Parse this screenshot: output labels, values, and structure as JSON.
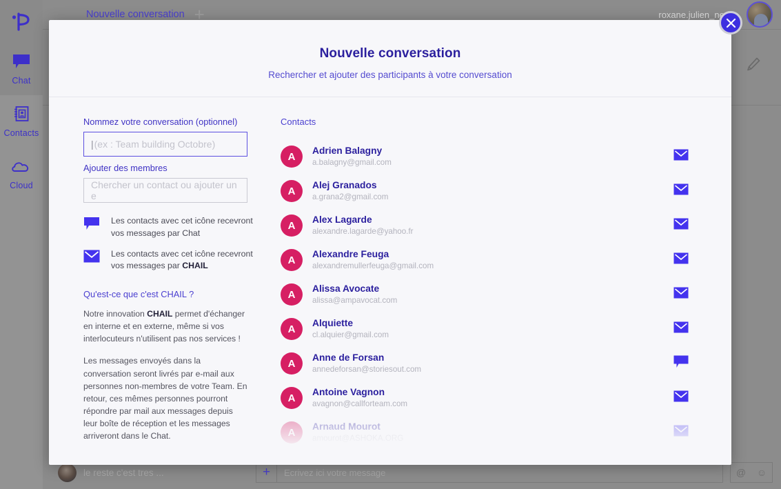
{
  "app": {
    "logo_icon": "phonegroup-p-logo-icon",
    "sidebar": {
      "items": [
        {
          "label": "Chat",
          "icon": "chat-bubble-icon",
          "active": true
        },
        {
          "label": "Contacts",
          "icon": "address-book-icon",
          "active": false
        },
        {
          "label": "Cloud",
          "icon": "cloud-icon",
          "active": false
        }
      ]
    },
    "topbar": {
      "tab_label": "Nouvelle conversation",
      "new_tab_icon": "plus-icon",
      "username": "roxane.julien_newm",
      "avatar_icon": "user-avatar"
    },
    "chat": {
      "edit_icon": "pencil-icon",
      "last_message_snippet": "le reste c'est tres ...",
      "composer_placeholder": "Ecrivez ici votre message",
      "attach_icon": "plus-icon",
      "mention_icon": "at-icon",
      "emoji_icon": "smiley-icon"
    }
  },
  "modal": {
    "title": "Nouvelle conversation",
    "subtitle": "Rechercher et ajouter des participants à votre conversation",
    "close_icon": "close-x-icon",
    "left": {
      "name_label": "Nommez votre conversation (optionnel)",
      "name_value": "",
      "name_placeholder": "(ex : Team building Octobre)",
      "members_label": "Ajouter des membres",
      "members_value": "",
      "members_placeholder": "Chercher un contact ou ajouter un e",
      "legend": [
        {
          "icon": "chat-bubble-icon",
          "text_before": "Les contacts avec cet icône recevront vos messages par ",
          "text_bold": "Chat",
          "bold_is_strong": false
        },
        {
          "icon": "mail-envelope-icon",
          "text_before": "Les contacts avec cet icône recevront vos messages par ",
          "text_bold": "CHAIL",
          "bold_is_strong": true
        }
      ],
      "faq_title": "Qu'est-ce que c'est CHAIL ?",
      "faq_p1_a": "Notre innovation ",
      "faq_p1_b": "CHAIL",
      "faq_p1_c": " permet d'échanger en interne et en externe, même si vos interlocuteurs n'utilisent pas nos services !",
      "faq_p2": "Les messages envoyés dans la conversation seront livrés par e-mail aux personnes non-membres de votre Team. En retour, ces mêmes personnes pourront répondre par mail aux messages depuis leur boîte de réception et les messages arriveront dans le Chat."
    },
    "right": {
      "contacts_label": "Contacts",
      "contacts": [
        {
          "initial": "A",
          "name": "Adrien Balagny",
          "email": "a.balagny@gmail.com",
          "channel": "mail",
          "faded": false
        },
        {
          "initial": "A",
          "name": "Alej Granados",
          "email": "a.grana2@gmail.com",
          "channel": "mail",
          "faded": false
        },
        {
          "initial": "A",
          "name": "Alex Lagarde",
          "email": "alexandre.lagarde@yahoo.fr",
          "channel": "mail",
          "faded": false
        },
        {
          "initial": "A",
          "name": "Alexandre Feuga",
          "email": "alexandremullerfeuga@gmail.com",
          "channel": "mail",
          "faded": false
        },
        {
          "initial": "A",
          "name": "Alissa Avocate",
          "email": "alissa@ampavocat.com",
          "channel": "mail",
          "faded": false
        },
        {
          "initial": "A",
          "name": "Alquiette",
          "email": "cl.alquier@gmail.com",
          "channel": "mail",
          "faded": false
        },
        {
          "initial": "A",
          "name": "Anne de Forsan",
          "email": "annedeforsan@storiesout.com",
          "channel": "chat",
          "faded": false
        },
        {
          "initial": "A",
          "name": "Antoine Vagnon",
          "email": "avagnon@callforteam.com",
          "channel": "mail",
          "faded": false
        },
        {
          "initial": "A",
          "name": "Arnaud Mourot",
          "email": "amourot@ASHOKA.ORG",
          "channel": "mail",
          "faded": true
        }
      ]
    }
  },
  "colors": {
    "accent_purple": "#3d2fe0",
    "title_purple": "#2b1f9e",
    "avatar_pink": "#d61f63",
    "modal_bg": "#f7f7fa",
    "app_bg": "#8c8c8c"
  }
}
